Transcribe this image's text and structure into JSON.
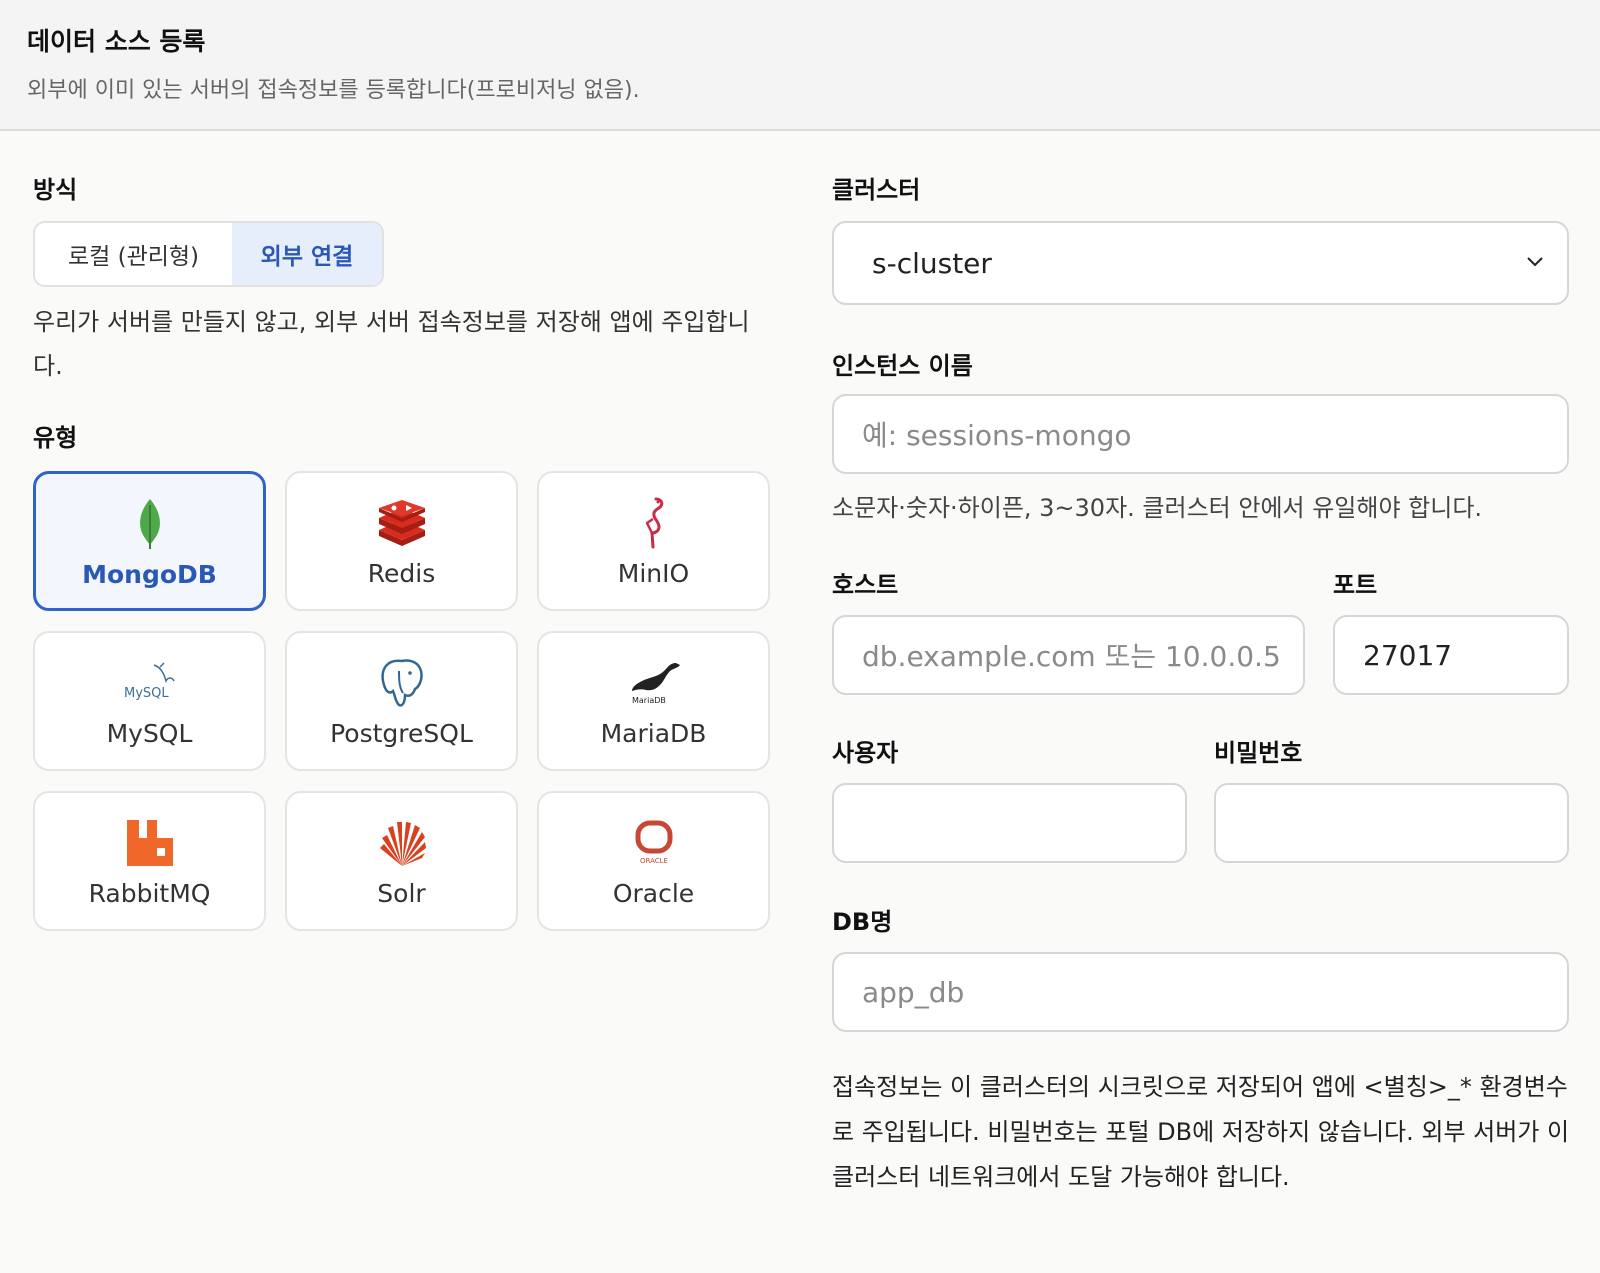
{
  "header": {
    "title": "데이터 소스 등록",
    "subtitle": "외부에 이미 있는 서버의 접속정보를 등록합니다(프로비저닝 없음)."
  },
  "method": {
    "label": "방식",
    "options": [
      "로컬 (관리형)",
      "외부 연결"
    ],
    "selected": "외부 연결",
    "description": "우리가 서버를 만들지 않고, 외부 서버 접속정보를 저장해 앱에 주입합니다."
  },
  "type": {
    "label": "유형",
    "selected": "MongoDB",
    "items": [
      {
        "name": "MongoDB",
        "icon": "mongodb-leaf-icon",
        "color": "#4fa84a"
      },
      {
        "name": "Redis",
        "icon": "redis-icon",
        "color": "#d82c20"
      },
      {
        "name": "MinIO",
        "icon": "minio-flamingo-icon",
        "color": "#c72c48"
      },
      {
        "name": "MySQL",
        "icon": "mysql-dolphin-icon",
        "color": "#3e6e93"
      },
      {
        "name": "PostgreSQL",
        "icon": "postgresql-elephant-icon",
        "color": "#336791"
      },
      {
        "name": "MariaDB",
        "icon": "mariadb-seal-icon",
        "color": "#222222"
      },
      {
        "name": "RabbitMQ",
        "icon": "rabbitmq-icon",
        "color": "#f0672a"
      },
      {
        "name": "Solr",
        "icon": "solr-sun-icon",
        "color": "#d9411e"
      },
      {
        "name": "Oracle",
        "icon": "oracle-icon",
        "color": "#c74634"
      }
    ],
    "logo_text": {
      "mysql": "MySQL",
      "mariadb": "MariaDB",
      "oracle": "ORACLE"
    }
  },
  "cluster": {
    "label": "클러스터",
    "value": "s-cluster"
  },
  "instance": {
    "label": "인스턴스 이름",
    "placeholder": "예: sessions-mongo",
    "hint": "소문자·숫자·하이픈, 3~30자. 클러스터 안에서 유일해야 합니다."
  },
  "host": {
    "label": "호스트",
    "placeholder": "db.example.com 또는 10.0.0.5"
  },
  "port": {
    "label": "포트",
    "value": "27017"
  },
  "user": {
    "label": "사용자",
    "value": ""
  },
  "password": {
    "label": "비밀번호",
    "value": ""
  },
  "dbname": {
    "label": "DB명",
    "placeholder": "app_db"
  },
  "note": "접속정보는 이 클러스터의 시크릿으로 저장되어 앱에 <별칭>_* 환경변수로 주입됩니다. 비밀번호는 포털 DB에 저장하지 않습니다. 외부 서버가 이 클러스터 네트워크에서 도달 가능해야 합니다.",
  "colors": {
    "accent": "#2f63c8",
    "accent_bg": "#e7eefb"
  }
}
